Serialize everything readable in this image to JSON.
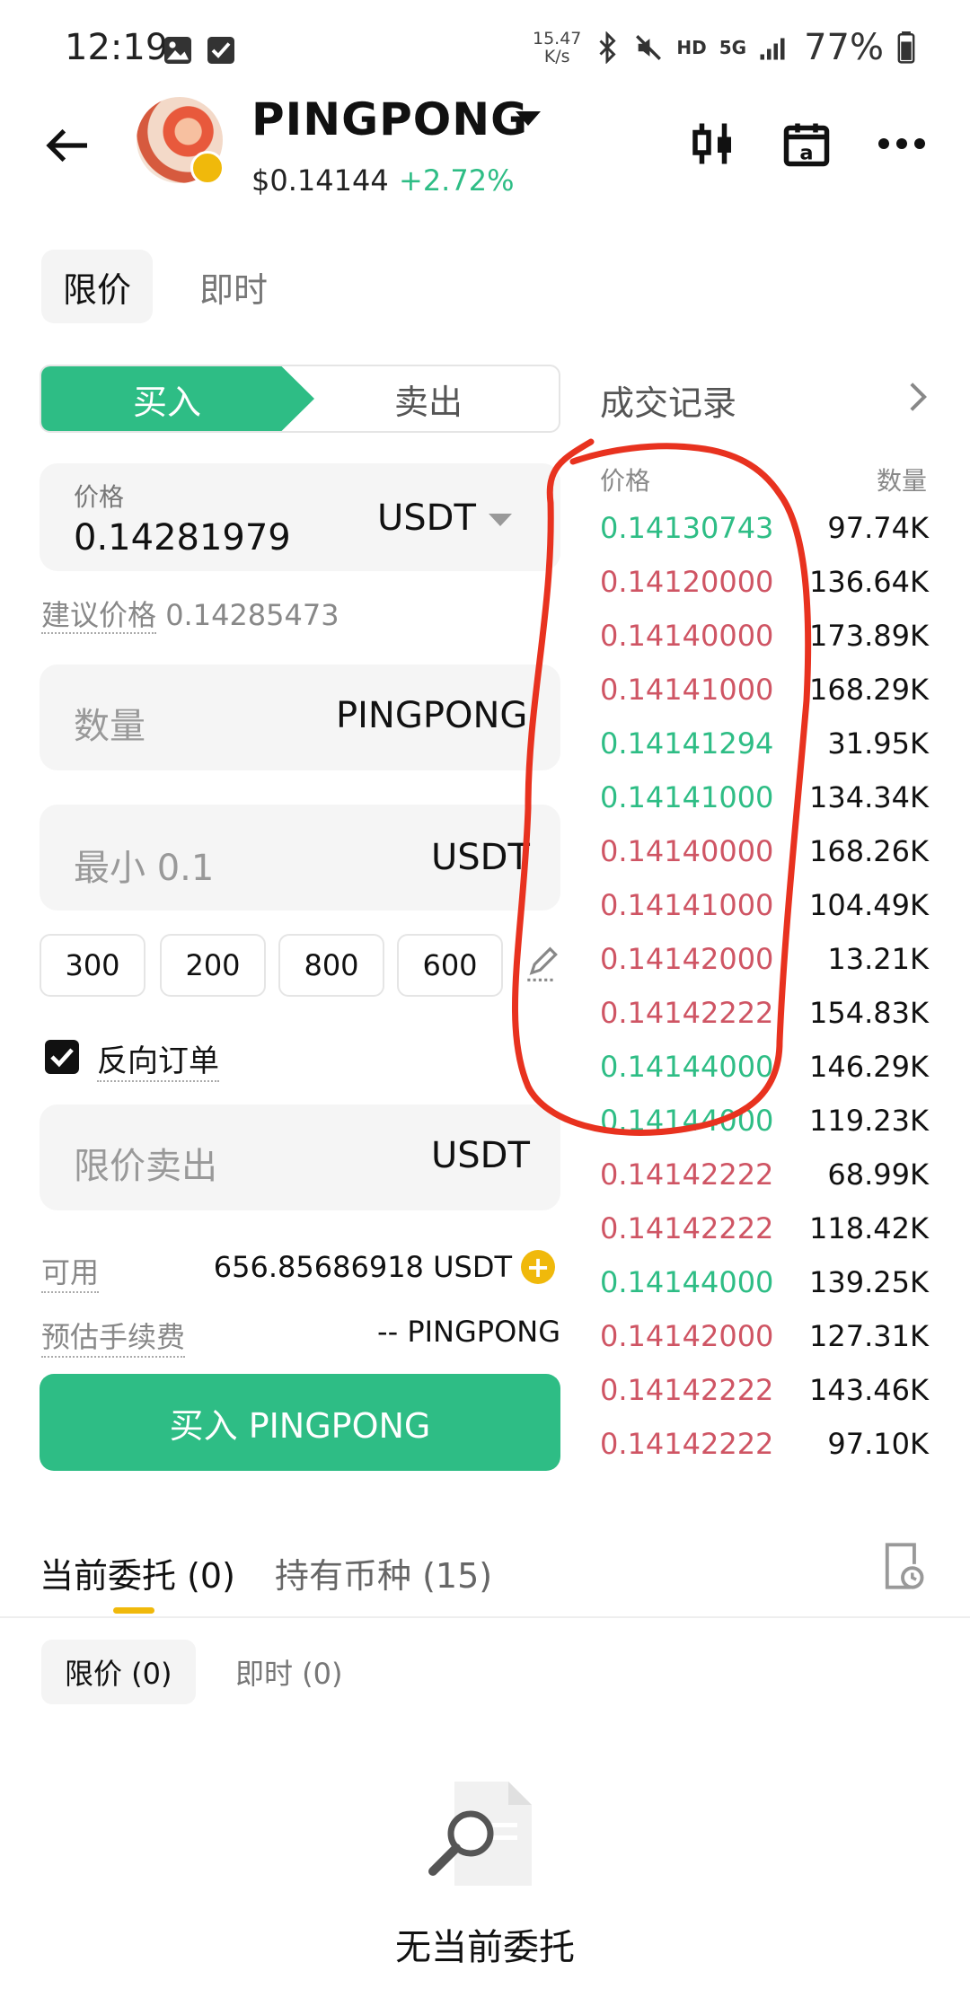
{
  "status_bar": {
    "time": "12:19",
    "net_speed_value": "15.47",
    "net_speed_unit": "K/s",
    "network": "5G",
    "hd": "HD",
    "battery": "77%"
  },
  "header": {
    "token_name": "PINGPONG",
    "price": "$0.14144",
    "change": "+2.72%"
  },
  "order_types": [
    "限价",
    "即时"
  ],
  "side_toggle": {
    "buy": "买入",
    "sell": "卖出"
  },
  "trade_history_link": "成交记录",
  "form": {
    "price_label": "价格",
    "price_value": "0.14281979",
    "price_unit": "USDT",
    "suggest_label": "建议价格",
    "suggest_value": "0.14285473",
    "quantity_placeholder": "数量",
    "quantity_unit": "PINGPONG",
    "total_placeholder": "最小 0.1",
    "total_unit": "USDT",
    "presets": [
      "300",
      "200",
      "800",
      "600"
    ],
    "reverse_order_label": "反向订单",
    "limit_sell_placeholder": "限价卖出",
    "limit_sell_unit": "USDT",
    "available_label": "可用",
    "available_value": "656.85686918 USDT",
    "fee_label": "预估手续费",
    "fee_value": "-- PINGPONG",
    "submit_label": "买入 PINGPONG"
  },
  "trades": {
    "price_header": "价格",
    "qty_header": "数量",
    "rows": [
      {
        "price": "0.14130743",
        "qty": "97.74K",
        "side": "up"
      },
      {
        "price": "0.14120000",
        "qty": "136.64K",
        "side": "down"
      },
      {
        "price": "0.14140000",
        "qty": "173.89K",
        "side": "down"
      },
      {
        "price": "0.14141000",
        "qty": "168.29K",
        "side": "down"
      },
      {
        "price": "0.14141294",
        "qty": "31.95K",
        "side": "up"
      },
      {
        "price": "0.14141000",
        "qty": "134.34K",
        "side": "up"
      },
      {
        "price": "0.14140000",
        "qty": "168.26K",
        "side": "down"
      },
      {
        "price": "0.14141000",
        "qty": "104.49K",
        "side": "down"
      },
      {
        "price": "0.14142000",
        "qty": "13.21K",
        "side": "down"
      },
      {
        "price": "0.14142222",
        "qty": "154.83K",
        "side": "down"
      },
      {
        "price": "0.14144000",
        "qty": "146.29K",
        "side": "up"
      },
      {
        "price": "0.14144000",
        "qty": "119.23K",
        "side": "up"
      },
      {
        "price": "0.14142222",
        "qty": "68.99K",
        "side": "down"
      },
      {
        "price": "0.14142222",
        "qty": "118.42K",
        "side": "down"
      },
      {
        "price": "0.14144000",
        "qty": "139.25K",
        "side": "up"
      },
      {
        "price": "0.14142000",
        "qty": "127.31K",
        "side": "down"
      },
      {
        "price": "0.14142222",
        "qty": "143.46K",
        "side": "down"
      },
      {
        "price": "0.14142222",
        "qty": "97.10K",
        "side": "down"
      }
    ]
  },
  "bottom_tabs": {
    "current_orders": "当前委托 (0)",
    "holdings": "持有币种 (15)"
  },
  "sub_tabs": {
    "limit": "限价 (0)",
    "instant": "即时 (0)"
  },
  "empty_state": "无当前委托",
  "colors": {
    "green": "#2ebd85",
    "red": "#cf5564",
    "yellow": "#f0b90b",
    "annotation": "#e8321f"
  }
}
